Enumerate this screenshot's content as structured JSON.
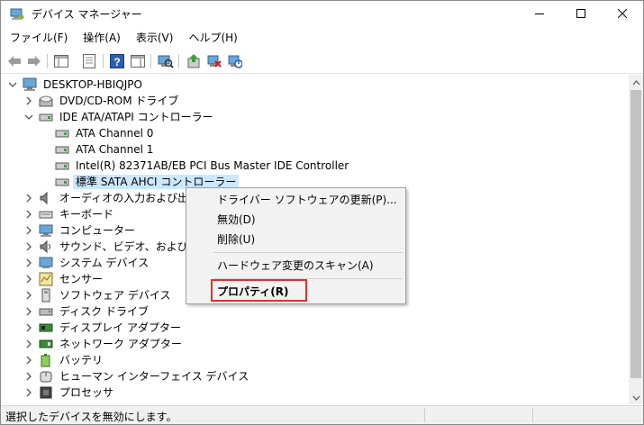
{
  "window": {
    "title": "デバイス マネージャー",
    "minimize_icon": "minimize-icon",
    "maximize_icon": "maximize-icon",
    "close_icon": "close-icon"
  },
  "menu": [
    "ファイル(F)",
    "操作(A)",
    "表示(V)",
    "ヘルプ(H)"
  ],
  "toolbar": [
    "back-arrow-icon",
    "forward-arrow-icon",
    "show-hide-console-tree-icon",
    "properties-icon",
    "help-icon",
    "action-pane-icon",
    "scan-hardware-icon",
    "update-driver-icon",
    "uninstall-device-icon",
    "enable-device-icon"
  ],
  "tree": {
    "root": "DESKTOP-HBIQJPO",
    "items": [
      {
        "label": "DVD/CD-ROM ドライブ",
        "icon": "dvd-drive-icon",
        "expanded": false
      },
      {
        "label": "IDE ATA/ATAPI コントローラー",
        "icon": "ide-controller-icon",
        "expanded": true
      },
      {
        "label": "ATA Channel 0",
        "icon": "ide-channel-icon",
        "child": true
      },
      {
        "label": "ATA Channel 1",
        "icon": "ide-channel-icon",
        "child": true
      },
      {
        "label": "Intel(R) 82371AB/EB PCI Bus Master IDE Controller",
        "icon": "ide-channel-icon",
        "child": true
      },
      {
        "label": "標準 SATA AHCI コントローラー",
        "icon": "ide-channel-icon",
        "child": true,
        "selected": true
      },
      {
        "label": "オーディオの入力および出力",
        "icon": "speaker-icon",
        "expanded": false
      },
      {
        "label": "キーボード",
        "icon": "keyboard-icon",
        "expanded": false
      },
      {
        "label": "コンピューター",
        "icon": "computer-icon",
        "expanded": false
      },
      {
        "label": "サウンド、ビデオ、およびゲーム コ",
        "icon": "sound-icon",
        "expanded": false
      },
      {
        "label": "システム デバイス",
        "icon": "system-device-icon",
        "expanded": false
      },
      {
        "label": "センサー",
        "icon": "sensor-icon",
        "expanded": false
      },
      {
        "label": "ソフトウェア デバイス",
        "icon": "software-device-icon",
        "expanded": false
      },
      {
        "label": "ディスク ドライブ",
        "icon": "disk-drive-icon",
        "expanded": false
      },
      {
        "label": "ディスプレイ アダプター",
        "icon": "display-adapter-icon",
        "expanded": false
      },
      {
        "label": "ネットワーク アダプター",
        "icon": "network-adapter-icon",
        "expanded": false
      },
      {
        "label": "バッテリ",
        "icon": "battery-icon",
        "expanded": false
      },
      {
        "label": "ヒューマン インターフェイス デバイス",
        "icon": "hid-icon",
        "expanded": false
      },
      {
        "label": "プロセッサ",
        "icon": "processor-icon",
        "expanded": false
      }
    ]
  },
  "context_menu": {
    "update_driver": "ドライバー ソフトウェアの更新(P)...",
    "disable": "無効(D)",
    "uninstall": "削除(U)",
    "scan": "ハードウェア変更のスキャン(A)",
    "properties": "プロパティ(R)"
  },
  "status": {
    "text": "選択したデバイスを無効にします。"
  },
  "colors": {
    "selection": "#cce8ff",
    "highlight_box": "#e03030"
  }
}
